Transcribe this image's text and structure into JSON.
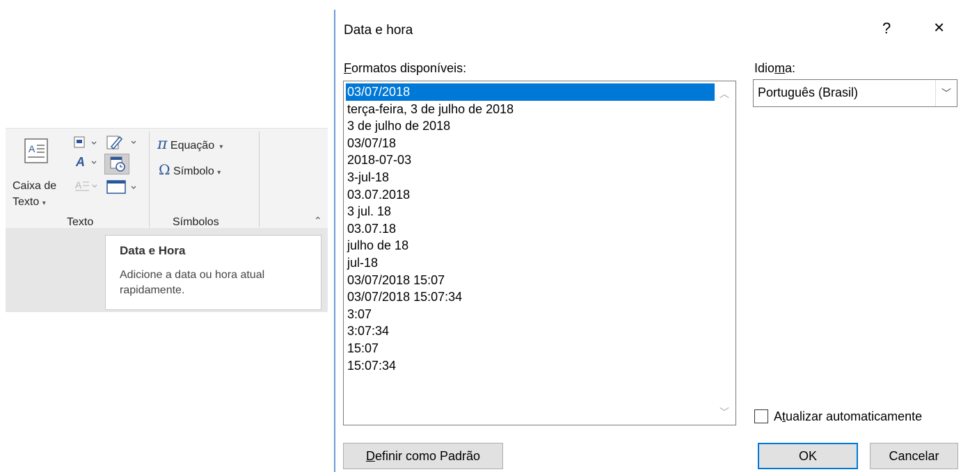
{
  "ribbon": {
    "caixa_line1": "Caixa de",
    "caixa_line2": "Texto",
    "equacao": "Equação",
    "simbolo": "Símbolo",
    "group_texto": "Texto",
    "group_simbolos": "Símbolos"
  },
  "tooltip": {
    "title": "Data e Hora",
    "description": "Adicione a data ou hora atual rapidamente."
  },
  "dialog": {
    "title": "Data e hora",
    "help": "?",
    "close": "×",
    "formats_label_first": "F",
    "formats_label_rest": "ormatos disponíveis:",
    "formats": [
      "03/07/2018",
      "terça-feira, 3 de julho de 2018",
      "3 de julho de 2018",
      "03/07/18",
      "2018-07-03",
      "3-jul-18",
      "03.07.2018",
      "3 jul. 18",
      "03.07.18",
      "julho de 18",
      "jul-18",
      "03/07/2018 15:07",
      "03/07/2018 15:07:34",
      "3:07",
      "3:07:34",
      "15:07",
      "15:07:34"
    ],
    "selected_index": 0,
    "language_label_a": "Idio",
    "language_label_u": "m",
    "language_label_b": "a:",
    "language_value": "Português (Brasil)",
    "auto_update_a": "A",
    "auto_update_u": "t",
    "auto_update_b": "ualizar automaticamente",
    "auto_update_checked": false,
    "set_default_u": "D",
    "set_default_rest": "efinir como Padrão",
    "ok": "OK",
    "cancel": "Cancelar"
  }
}
